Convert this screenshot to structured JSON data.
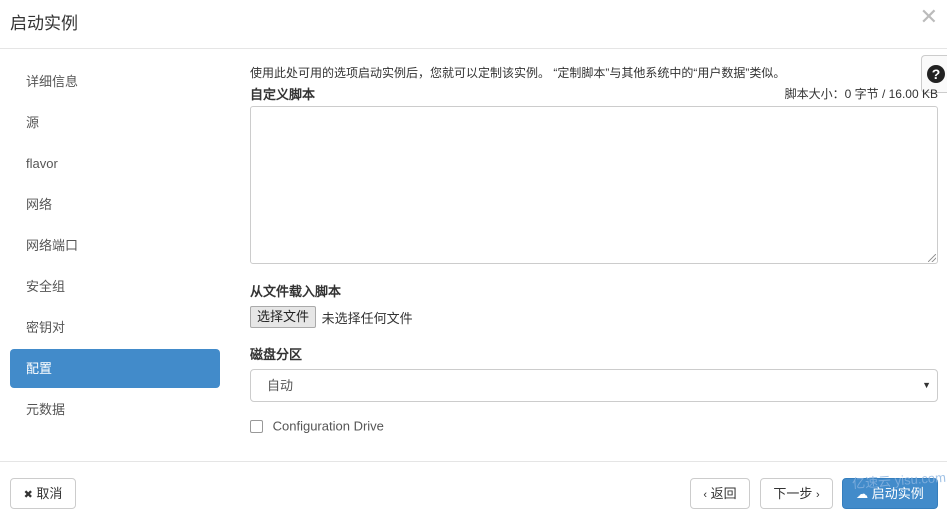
{
  "header": {
    "title": "启动实例",
    "close_glyph": "✕"
  },
  "help_icon_glyph": "?",
  "sidebar": {
    "items": [
      {
        "label": "详细信息",
        "active": false
      },
      {
        "label": "源",
        "active": false
      },
      {
        "label": "flavor",
        "active": false
      },
      {
        "label": "网络",
        "active": false
      },
      {
        "label": "网络端口",
        "active": false
      },
      {
        "label": "安全组",
        "active": false
      },
      {
        "label": "密钥对",
        "active": false
      },
      {
        "label": "配置",
        "active": true
      },
      {
        "label": "元数据",
        "active": false
      }
    ]
  },
  "main": {
    "description": "使用此处可用的选项启动实例后，您就可以定制该实例。 “定制脚本”与其他系统中的“用户数据”类似。",
    "custom_script_label": "自定义脚本",
    "script_size": "脚本大小：0 字节 / 16.00 KB",
    "custom_script_value": "",
    "file_load_label": "从文件载入脚本",
    "file_button_label": "选择文件",
    "file_status": "未选择任何文件",
    "disk_partition_label": "磁盘分区",
    "disk_partition_value": "自动",
    "config_drive_label": "Configuration Drive",
    "config_drive_checked": false
  },
  "footer": {
    "cancel_label": "取消",
    "back_label": "返回",
    "next_label": "下一步",
    "launch_label": "启动实例"
  },
  "watermark": "亿速云 yisu.com",
  "colors": {
    "accent": "#428bca",
    "border": "#cccccc"
  }
}
